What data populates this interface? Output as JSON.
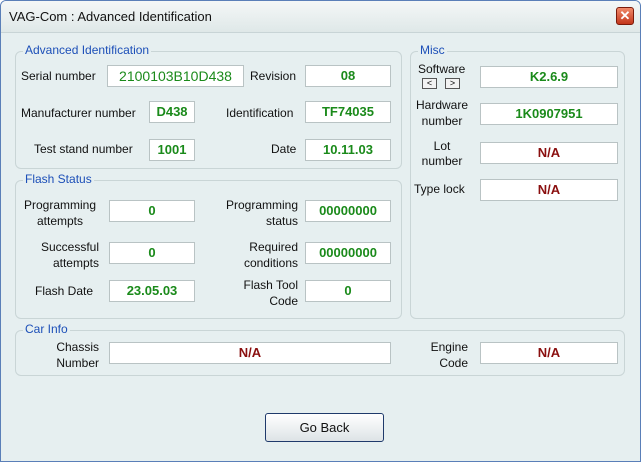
{
  "window": {
    "title": "VAG-Com : Advanced Identification"
  },
  "advanced": {
    "group_label": "Advanced Identification",
    "serial_label": "Serial number",
    "serial_value": "2100103B10D438",
    "revision_label": "Revision",
    "revision_value": "08",
    "manufacturer_label": "Manufacturer number",
    "manufacturer_value": "D438",
    "identification_label": "Identification",
    "identification_value": "TF74035",
    "teststand_label": "Test stand number",
    "teststand_value": "1001",
    "date_label": "Date",
    "date_value": "10.11.03"
  },
  "misc": {
    "group_label": "Misc",
    "software_label": "Software",
    "software_value": "K2.6.9",
    "spin_left": "<",
    "spin_right": ">",
    "hardware_label_1": "Hardware",
    "hardware_label_2": "number",
    "hardware_value": "1K0907951",
    "lot_label_1": "Lot",
    "lot_label_2": "number",
    "lot_value": "N/A",
    "typelock_label": "Type lock",
    "typelock_value": "N/A"
  },
  "flash": {
    "group_label": "Flash Status",
    "prog_attempts_label_1": "Programming",
    "prog_attempts_label_2": "attempts",
    "prog_attempts_value": "0",
    "prog_status_label_1": "Programming",
    "prog_status_label_2": "status",
    "prog_status_value": "00000000",
    "succ_attempts_label_1": "Successful",
    "succ_attempts_label_2": "attempts",
    "succ_attempts_value": "0",
    "req_cond_label_1": "Required",
    "req_cond_label_2": "conditions",
    "req_cond_value": "00000000",
    "flash_date_label": "Flash Date",
    "flash_date_value": "23.05.03",
    "flash_tool_label_1": "Flash Tool",
    "flash_tool_label_2": "Code",
    "flash_tool_value": "0"
  },
  "car": {
    "group_label": "Car Info",
    "chassis_label_1": "Chassis",
    "chassis_label_2": "Number",
    "chassis_value": "N/A",
    "engine_label_1": "Engine",
    "engine_label_2": "Code",
    "engine_value": "N/A"
  },
  "buttons": {
    "go_back": "Go Back"
  }
}
